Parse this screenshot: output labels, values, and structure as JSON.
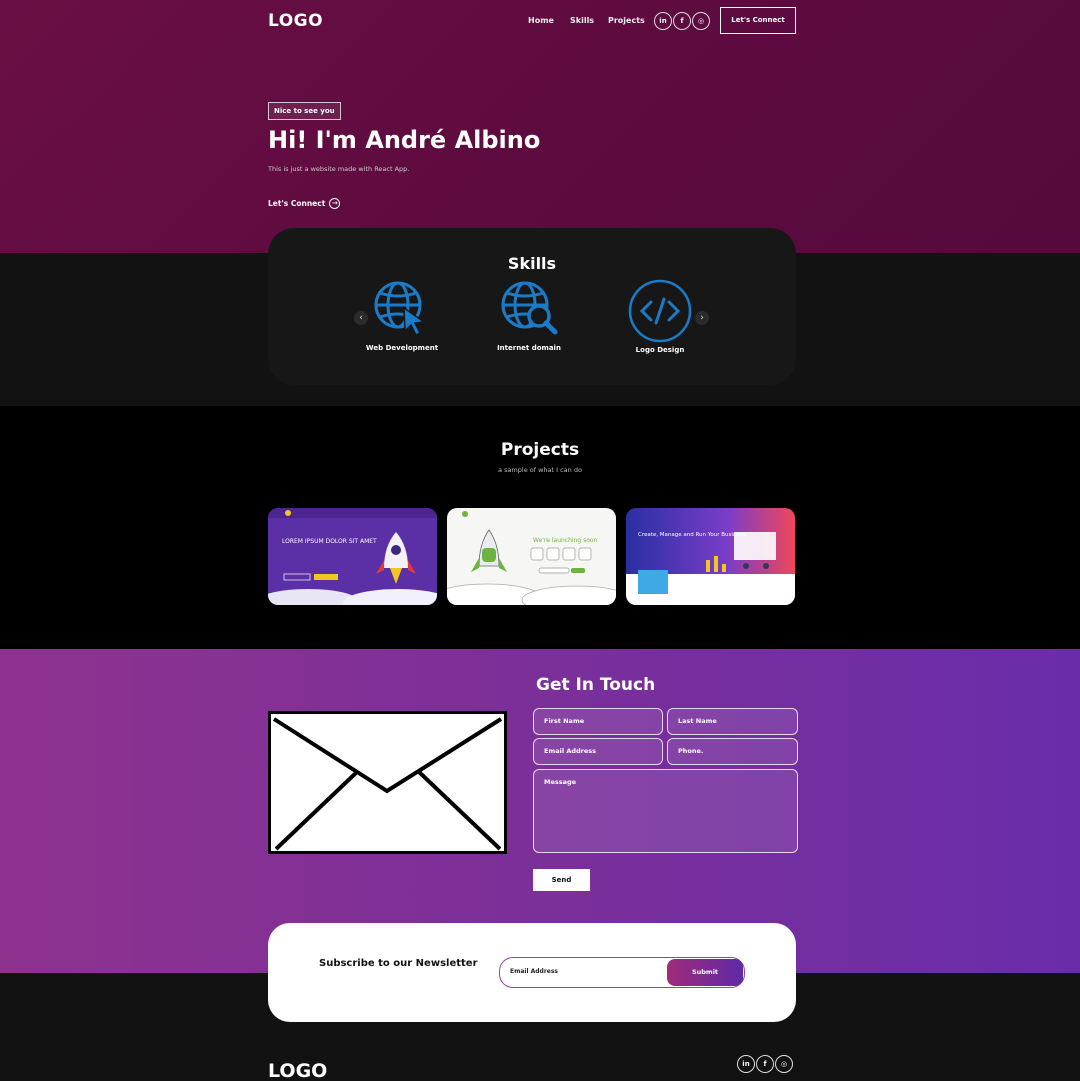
{
  "header": {
    "logo": "LOGO",
    "nav": [
      "Home",
      "Skills",
      "Projects"
    ],
    "social": [
      "in",
      "f",
      "ig"
    ],
    "connect_label": "Let's Connect"
  },
  "hero": {
    "tagline": "Nice to see you",
    "title": "Hi! I'm André Albino",
    "subtitle": "This is just a website made with React App.",
    "cta_label": "Let's Connect"
  },
  "skills": {
    "title": "Skills",
    "items": [
      {
        "label": "Web Development",
        "icon": "globe-cursor-icon"
      },
      {
        "label": "Internet domain",
        "icon": "globe-search-icon"
      },
      {
        "label": "Logo Design",
        "icon": "code-icon"
      }
    ],
    "accent": "#1a7bc8"
  },
  "projects": {
    "title": "Projects",
    "subtitle": "a sample of what I can do",
    "thumbs": [
      {
        "caption": "LOREM IPSUM DOLOR SIT AMET"
      },
      {
        "caption": "We're launching soon"
      },
      {
        "caption": "Create, Manage and Run Your Business"
      }
    ]
  },
  "contact": {
    "title": "Get In Touch",
    "first_name": "First Name",
    "last_name": "Last Name",
    "email": "Email Address",
    "phone": "Phone.",
    "message": "Message",
    "send_label": "Send"
  },
  "newsletter": {
    "label": "Subscribe to our Newsletter",
    "placeholder": "Email Address",
    "submit_label": "Submit"
  },
  "footer": {
    "logo": "LOGO",
    "social": [
      "in",
      "f",
      "ig"
    ]
  }
}
